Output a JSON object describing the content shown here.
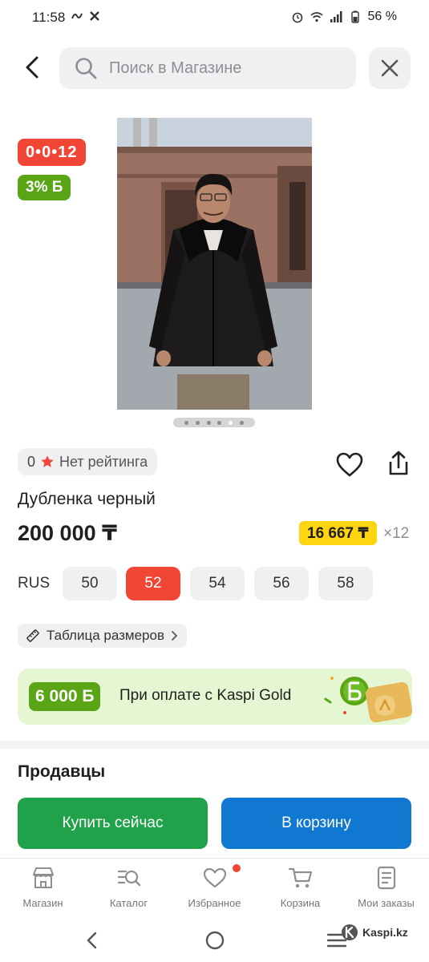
{
  "status_bar": {
    "time": "11:58",
    "battery": "56 %"
  },
  "search": {
    "placeholder": "Поиск в Магазине"
  },
  "badges": {
    "timer": "0•0•12",
    "bonus": "3% Б"
  },
  "gallery": {
    "slide_count": 6,
    "active_slide": 5
  },
  "rating": {
    "value": "0",
    "label": "Нет рейтинга"
  },
  "product": {
    "title": "Дубленка черный",
    "price": "200 000 ₸",
    "credit_monthly": "16 667 ₸",
    "credit_months": "×12"
  },
  "sizes": {
    "label": "RUS",
    "options": [
      "50",
      "52",
      "54",
      "56",
      "58"
    ],
    "selected": "52"
  },
  "size_table": {
    "label": "Таблица размеров"
  },
  "kaspi_gold": {
    "amount": "6 000 Б",
    "text": "При оплате с Kaspi Gold"
  },
  "sellers": {
    "title": "Продавцы"
  },
  "actions": {
    "buy_now": "Купить сейчас",
    "add_to_cart": "В корзину"
  },
  "bottom_nav": {
    "items": [
      {
        "label": "Магазин",
        "icon": "shop-icon"
      },
      {
        "label": "Каталог",
        "icon": "catalog-icon"
      },
      {
        "label": "Избранное",
        "icon": "heart-icon"
      },
      {
        "label": "Корзина",
        "icon": "cart-icon"
      },
      {
        "label": "Мои заказы",
        "icon": "orders-icon"
      }
    ]
  },
  "watermark": {
    "text": "Kaspi.kz"
  },
  "colors": {
    "red": "#f14635",
    "green": "#21a24a",
    "blue": "#1178d2",
    "yellow": "#ffd511",
    "bonus_green": "#5aa516"
  }
}
